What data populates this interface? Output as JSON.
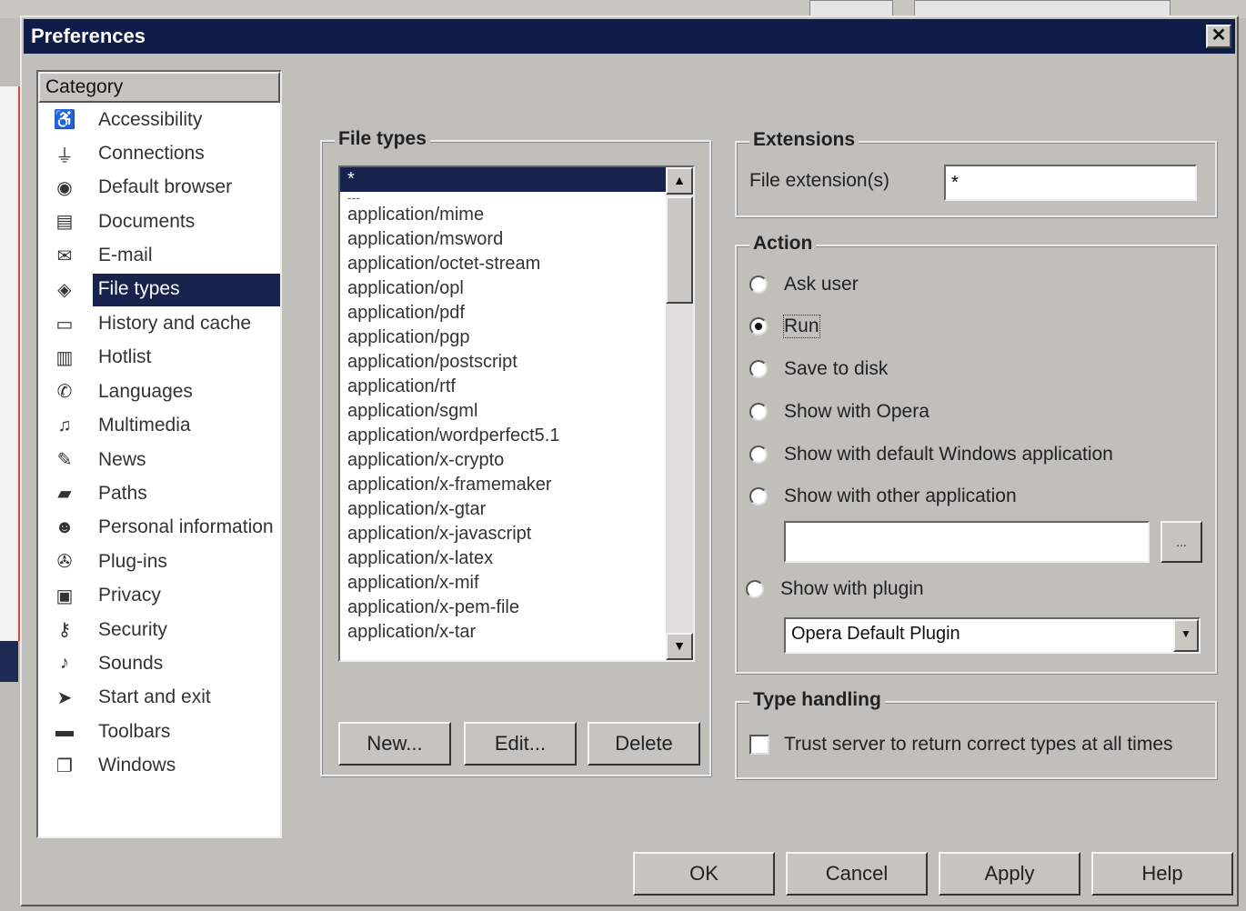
{
  "dialog": {
    "title": "Preferences",
    "close_glyph": "✕"
  },
  "category": {
    "header": "Category",
    "items": [
      {
        "label": "Accessibility",
        "icon": "accessibility-icon",
        "glyph": "♿"
      },
      {
        "label": "Connections",
        "icon": "connections-icon",
        "glyph": "⏚"
      },
      {
        "label": "Default browser",
        "icon": "default-browser-icon",
        "glyph": "◉"
      },
      {
        "label": "Documents",
        "icon": "documents-icon",
        "glyph": "▤"
      },
      {
        "label": "E-mail",
        "icon": "email-icon",
        "glyph": "✉"
      },
      {
        "label": "File types",
        "icon": "file-types-icon",
        "glyph": "◈"
      },
      {
        "label": "History and cache",
        "icon": "history-cache-icon",
        "glyph": "▭"
      },
      {
        "label": "Hotlist",
        "icon": "hotlist-icon",
        "glyph": "▥"
      },
      {
        "label": "Languages",
        "icon": "languages-icon",
        "glyph": "✆"
      },
      {
        "label": "Multimedia",
        "icon": "multimedia-icon",
        "glyph": "♫"
      },
      {
        "label": "News",
        "icon": "news-icon",
        "glyph": "✎"
      },
      {
        "label": "Paths",
        "icon": "paths-icon",
        "glyph": "▰"
      },
      {
        "label": "Personal information",
        "icon": "personal-info-icon",
        "glyph": "☻"
      },
      {
        "label": "Plug-ins",
        "icon": "plugins-icon",
        "glyph": "✇"
      },
      {
        "label": "Privacy",
        "icon": "privacy-icon",
        "glyph": "▣"
      },
      {
        "label": "Security",
        "icon": "security-icon",
        "glyph": "⚷"
      },
      {
        "label": "Sounds",
        "icon": "sounds-icon",
        "glyph": "♪"
      },
      {
        "label": "Start and exit",
        "icon": "start-exit-icon",
        "glyph": "➤"
      },
      {
        "label": "Toolbars",
        "icon": "toolbars-icon",
        "glyph": "▬"
      },
      {
        "label": "Windows",
        "icon": "windows-icon",
        "glyph": "❐"
      }
    ],
    "selected": "File types"
  },
  "file_types": {
    "legend": "File types",
    "selected_item": "*",
    "separator": "---",
    "items": [
      "application/mime",
      "application/msword",
      "application/octet-stream",
      "application/opl",
      "application/pdf",
      "application/pgp",
      "application/postscript",
      "application/rtf",
      "application/sgml",
      "application/wordperfect5.1",
      "application/x-crypto",
      "application/x-framemaker",
      "application/x-gtar",
      "application/x-javascript",
      "application/x-latex",
      "application/x-mif",
      "application/x-pem-file",
      "application/x-tar"
    ],
    "scroll_up": "▲",
    "scroll_down": "▼",
    "buttons": {
      "new": "New...",
      "edit": "Edit...",
      "delete": "Delete"
    }
  },
  "extensions": {
    "legend": "Extensions",
    "label": "File extension(s)",
    "value": "*"
  },
  "action": {
    "legend": "Action",
    "options": [
      {
        "label": "Ask user",
        "checked": false
      },
      {
        "label": "Run",
        "checked": true
      },
      {
        "label": "Save to disk",
        "checked": false
      },
      {
        "label": "Show with Opera",
        "checked": false
      },
      {
        "label": "Show with default Windows application",
        "checked": false
      },
      {
        "label": "Show with other application",
        "checked": false
      },
      {
        "label": "Show with plugin",
        "checked": false
      }
    ],
    "other_app_value": "",
    "browse_label": "...",
    "plugin_value": "Opera Default Plugin",
    "dropdown_glyph": "▼"
  },
  "type_handling": {
    "legend": "Type handling",
    "checkbox_label": "Trust server to return correct types at all times",
    "checked": false
  },
  "footer": {
    "ok": "OK",
    "cancel": "Cancel",
    "apply": "Apply",
    "help": "Help"
  }
}
